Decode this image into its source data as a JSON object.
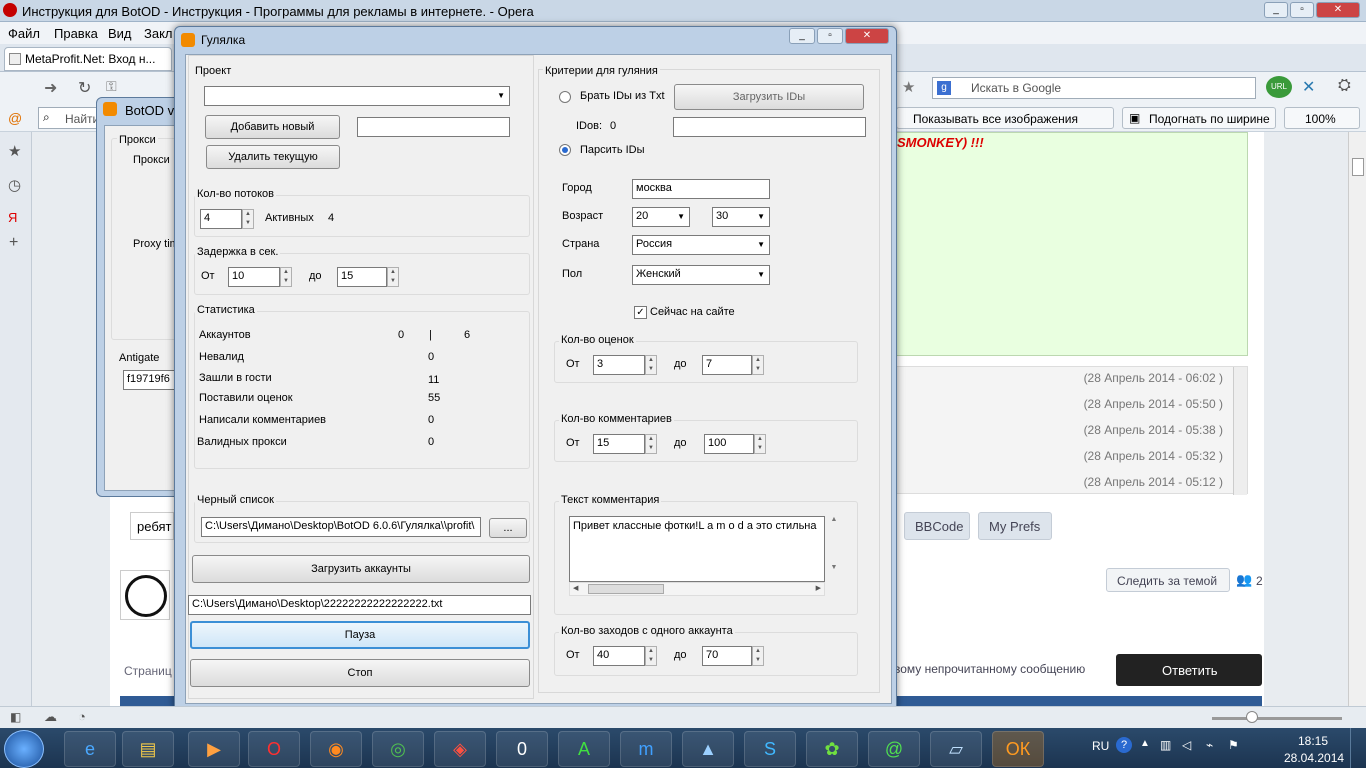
{
  "browser": {
    "title": "Инструкция для BotOD - Инструкция - Программы для рекламы в интернете. - Opera",
    "menu": [
      "Файл",
      "Правка",
      "Вид",
      "Закл"
    ],
    "tab_label": "MetaProfit.Net: Вход н...",
    "search_placeholder": "Искать в Google",
    "show_images": "Показывать все изображения",
    "fit_width": "Подогнать по ширине",
    "zoom": "100%",
    "find_placeholder": "Найти"
  },
  "page": {
    "warning": "SMONKEY) !!!",
    "dates": [
      "(28 Апрель 2014 - 06:02 )",
      "(28 Апрель 2014 - 05:50 )",
      "(28 Апрель 2014 - 05:38 )",
      "(28 Апрель 2014 - 05:32 )",
      "(28 Апрель 2014 - 05:12 )"
    ],
    "reply_text": "ребят",
    "bbcode": "BBCode",
    "my_prefs": "My Prefs",
    "follow_topic": "Следить за темой",
    "followers": "2",
    "pages_label": "Страниц",
    "unread_link": "вому непрочитанному сообщению",
    "reply_button": "Ответить"
  },
  "botod": {
    "title": "BotOD  v",
    "proxy_group": "Прокси",
    "proxy_label": "Прокси",
    "proxy_timeout": "Proxy tim",
    "antigate": "Antigate",
    "antigate_key": "f19719f6"
  },
  "dialog": {
    "title": "Гулялка",
    "project": {
      "label": "Проект",
      "selected": "",
      "add_button": "Добавить новый",
      "new_name": "",
      "delete_button": "Удалить текущую"
    },
    "threads": {
      "label": "Кол-во потоков",
      "value": "4",
      "active_label": "Активных",
      "active_value": "4"
    },
    "delay": {
      "label": "Задержка в сек.",
      "from_label": "От",
      "from": "10",
      "to_label": "до",
      "to": "15"
    },
    "stats": {
      "label": "Статистика",
      "rows": [
        {
          "name": "Аккаунтов",
          "a": "0",
          "sep": "|",
          "b": "6"
        },
        {
          "name": "Невалид",
          "v": "0"
        },
        {
          "name": "Зашли в гости",
          "v": "11"
        },
        {
          "name": "Поставили оценок",
          "v": "55"
        },
        {
          "name": "Написали комментариев",
          "v": "0"
        },
        {
          "name": "Валидных прокси",
          "v": "0"
        }
      ]
    },
    "blacklist": {
      "label": "Черный список",
      "path": "C:\\Users\\Димано\\Desktop\\BotOD 6.0.6\\Гулялка\\\\profit\\",
      "browse": "..."
    },
    "load_accounts": "Загрузить аккаунты",
    "accounts_path": "C:\\Users\\Димано\\Desktop\\22222222222222222.txt",
    "pause": "Пауза",
    "stop": "Стоп",
    "criteria": {
      "label": "Критерии для гуляния",
      "take_ids": "Брать IDы из Txt",
      "load_ids": "Загрузить IDы",
      "ids_label": "IDов:",
      "ids_count": "0",
      "ids_value": "",
      "parse_ids": "Парсить IDы",
      "city_label": "Город",
      "city": "москва",
      "age_label": "Возраст",
      "age_from": "20",
      "age_to": "30",
      "country_label": "Страна",
      "country": "Россия",
      "sex_label": "Пол",
      "sex": "Женский",
      "online_label": "Сейчас на сайте"
    },
    "ratings": {
      "label": "Кол-во оценок",
      "from_label": "От",
      "from": "3",
      "to_label": "до",
      "to": "7"
    },
    "comments": {
      "label": "Кол-во комментариев",
      "from_label": "От",
      "from": "15",
      "to_label": "до",
      "to": "100"
    },
    "comment_text": {
      "label": "Текст комментария",
      "value": "Привет классные фотки!L a m o d a это стильна"
    },
    "visits": {
      "label": "Кол-во заходов с одного аккаунта",
      "from_label": "От",
      "from": "40",
      "to_label": "до",
      "to": "70"
    }
  },
  "taskbar": {
    "lang": "RU",
    "time": "18:15",
    "date": "28.04.2014"
  }
}
